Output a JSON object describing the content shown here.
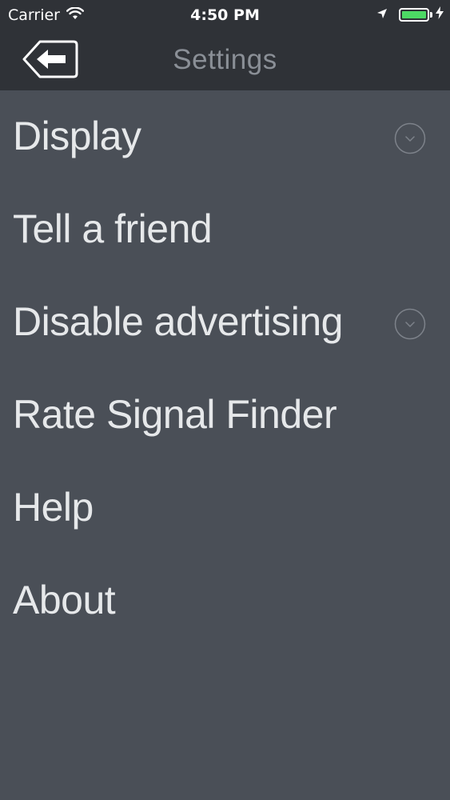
{
  "status_bar": {
    "carrier": "Carrier",
    "time": "4:50 PM",
    "battery_color": "#4cd964"
  },
  "nav": {
    "title": "Settings",
    "back_icon": "back-arrow-icon"
  },
  "menu": {
    "items": [
      {
        "label": "Display",
        "has_chevron": true
      },
      {
        "label": "Tell a friend",
        "has_chevron": false
      },
      {
        "label": "Disable advertising",
        "has_chevron": true
      },
      {
        "label": "Rate Signal Finder",
        "has_chevron": false
      },
      {
        "label": "Help",
        "has_chevron": false
      },
      {
        "label": "About",
        "has_chevron": false
      }
    ]
  },
  "colors": {
    "background": "#4a4f57",
    "bar": "#2f3237",
    "title": "#8a8f96",
    "text": "#e6e8ea"
  }
}
